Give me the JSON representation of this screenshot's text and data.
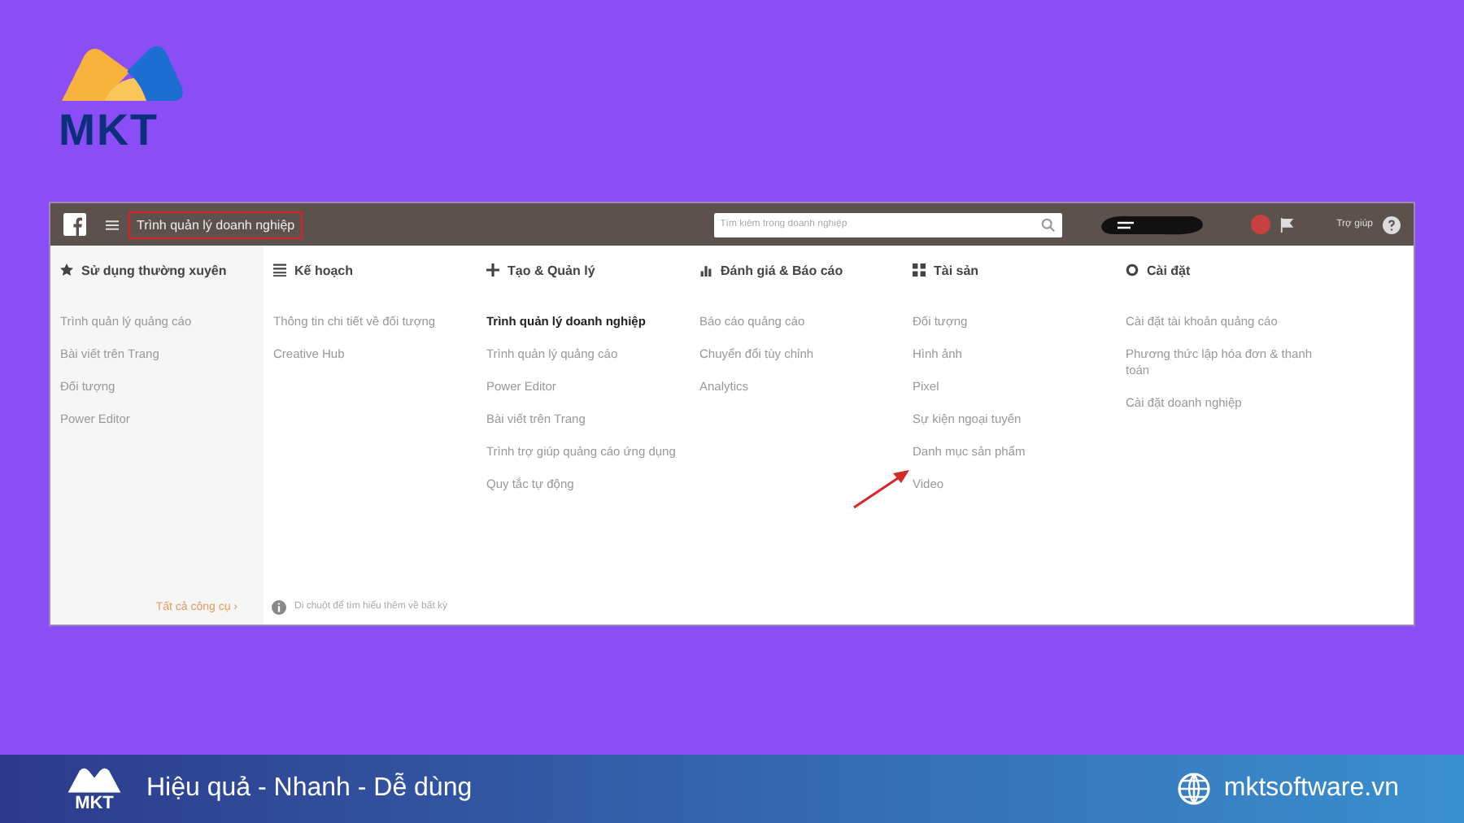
{
  "logo": {
    "text": "MKT"
  },
  "screen": {
    "topbar": {
      "title": "Trình quản lý doanh nghiệp",
      "search": {
        "placeholder": "Tìm kiếm trong doanh nghiệp"
      },
      "help": "Trợ giúp"
    },
    "columns": [
      {
        "kind": "star",
        "title": "Sử dụng thường xuyên",
        "items": [
          {
            "text": "Trình quản lý quảng cáo",
            "bold": false
          },
          {
            "text": "Bài viết trên Trang",
            "bold": false
          },
          {
            "text": "Đối tượng",
            "bold": false
          },
          {
            "text": "Power Editor",
            "bold": false
          }
        ]
      },
      {
        "kind": "list",
        "title": "Kế hoạch",
        "items": [
          {
            "text": "Thông tin chi tiết về đối tượng",
            "bold": false
          },
          {
            "text": "Creative Hub",
            "bold": false
          }
        ]
      },
      {
        "kind": "plus",
        "title": "Tạo & Quản lý",
        "items": [
          {
            "text": "Trình quản lý doanh nghiệp",
            "bold": true
          },
          {
            "text": "Trình quản lý quảng cáo",
            "bold": false
          },
          {
            "text": "Power Editor",
            "bold": false
          },
          {
            "text": "Bài viết trên Trang",
            "bold": false
          },
          {
            "text": "Trình trợ giúp quảng cáo ứng dụng",
            "bold": false
          },
          {
            "text": "Quy tắc tự động",
            "bold": false
          }
        ]
      },
      {
        "kind": "chart",
        "title": "Đánh giá & Báo cáo",
        "items": [
          {
            "text": "Báo cáo quảng cáo",
            "bold": false
          },
          {
            "text": "Chuyển đổi tùy chỉnh",
            "bold": false
          },
          {
            "text": "Analytics",
            "bold": false
          }
        ]
      },
      {
        "kind": "grid",
        "title": "Tài sản",
        "items": [
          {
            "text": "Đối tượng",
            "bold": false
          },
          {
            "text": "Hình ảnh",
            "bold": false
          },
          {
            "text": "Pixel",
            "bold": false
          },
          {
            "text": "Sự kiện ngoại tuyến",
            "bold": false
          },
          {
            "text": "Danh mục sản phẩm",
            "bold": false
          },
          {
            "text": "Video",
            "bold": false
          }
        ]
      },
      {
        "kind": "gear",
        "title": "Cài đặt",
        "items": [
          {
            "text": "Cài đặt tài khoản quảng cáo",
            "bold": false
          },
          {
            "text": "Phương thức lập hóa đơn & thanh toán",
            "bold": false
          },
          {
            "text": "Cài đặt doanh nghiệp",
            "bold": false
          }
        ]
      }
    ],
    "all_tools": "Tất cả công cụ ›",
    "hint": "Di chuột để tìm hiểu thêm về bất kỳ"
  },
  "footer": {
    "logo": "MKT",
    "slogan": "Hiệu quả - Nhanh - Dễ dùng",
    "website": "mktsoftware.vn"
  }
}
